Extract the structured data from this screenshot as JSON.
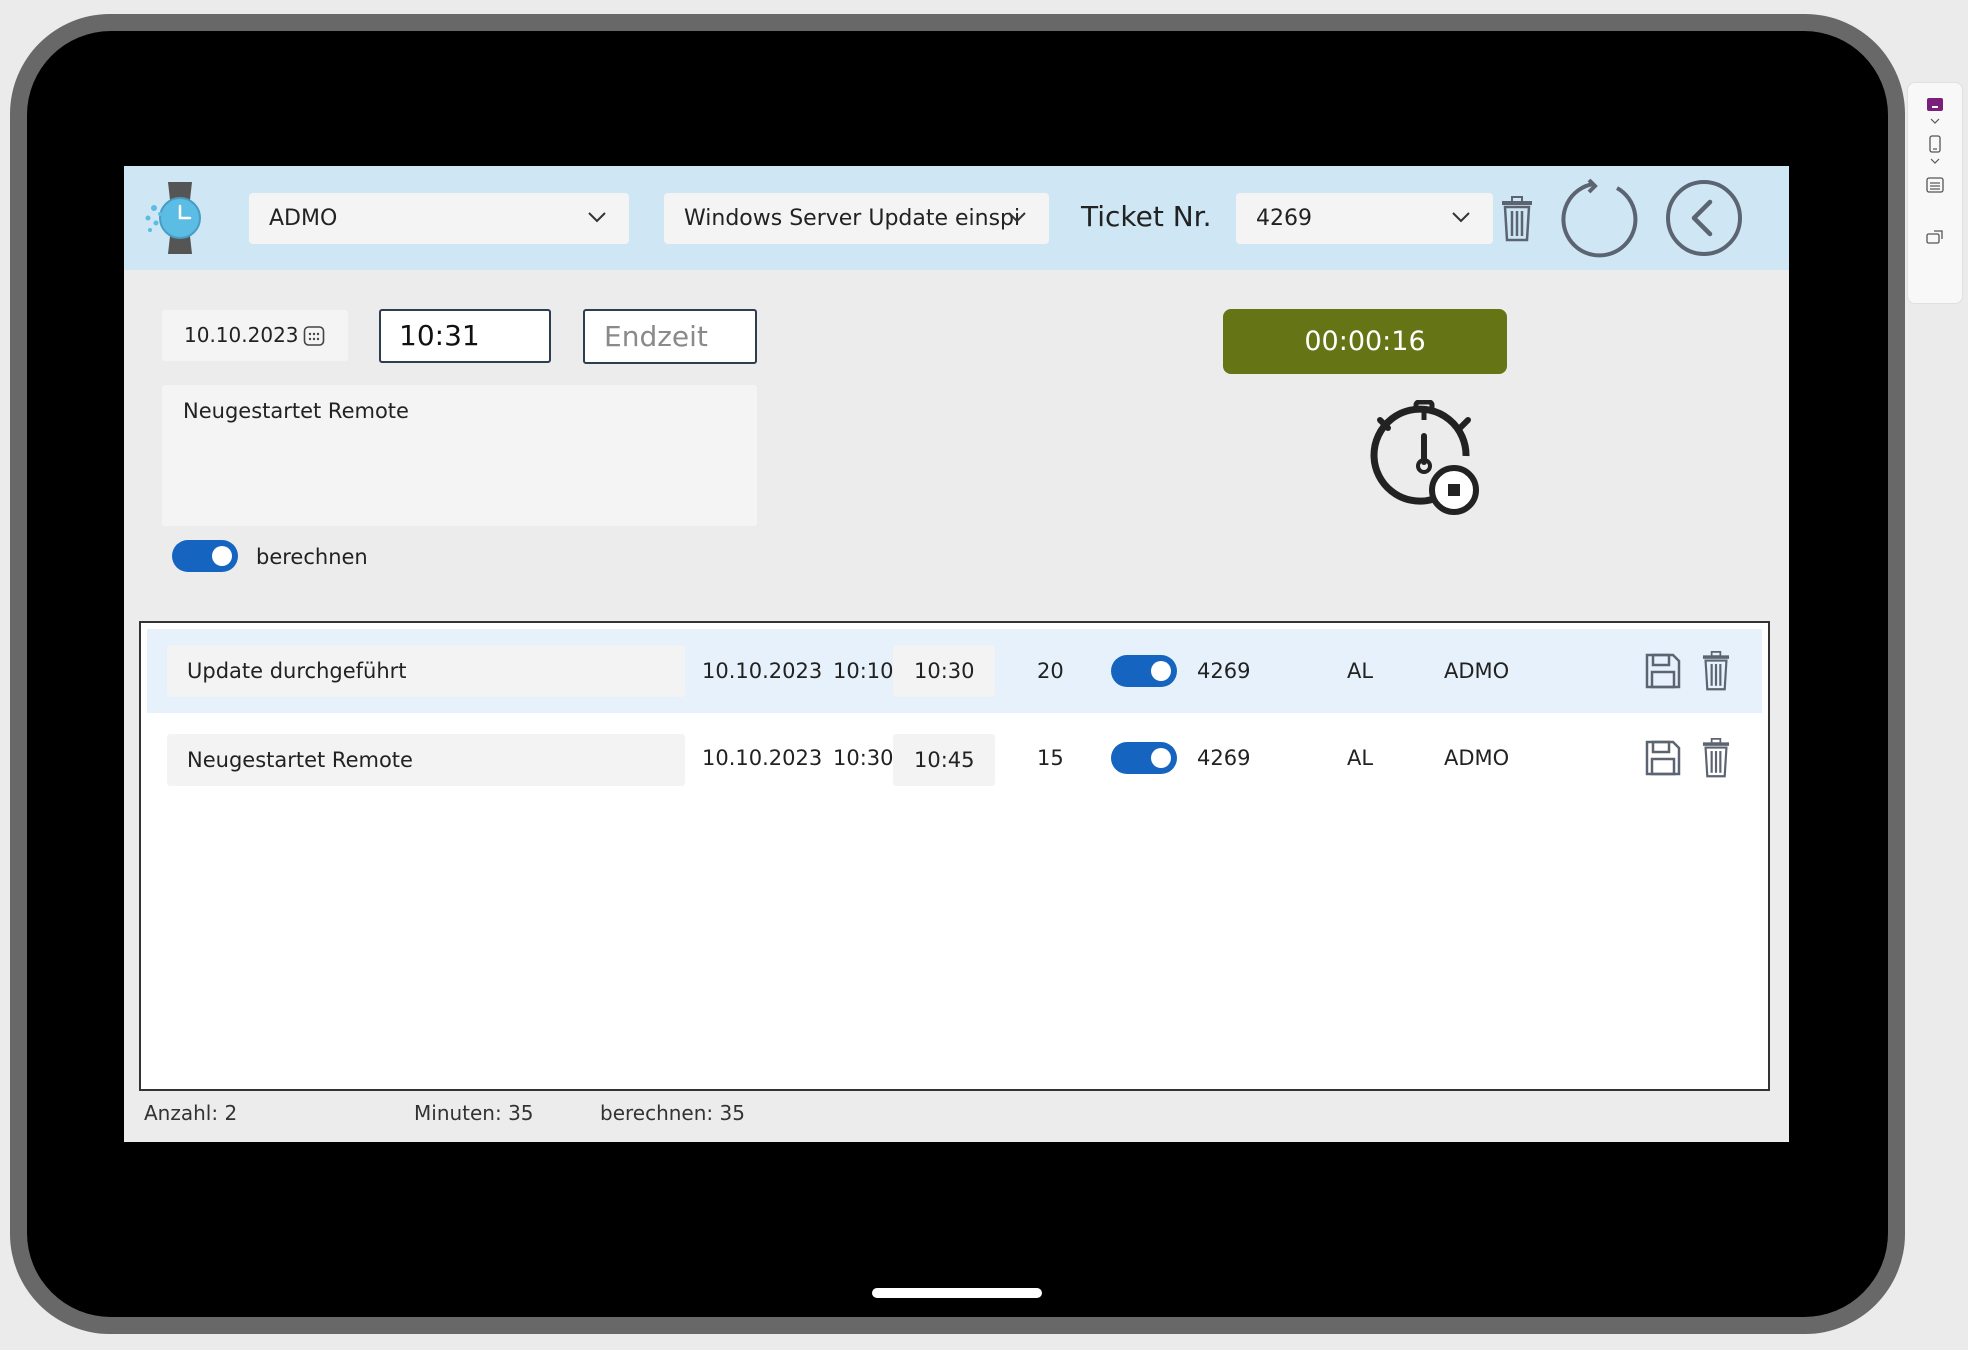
{
  "header": {
    "customer_dropdown": "ADMO",
    "task_dropdown": "Windows Server Update einspi",
    "ticket_label": "Ticket Nr.",
    "ticket_dropdown": "4269"
  },
  "form": {
    "date": "10.10.2023",
    "start_time": "10:31",
    "end_time_placeholder": "Endzeit",
    "note": "Neugestartet Remote",
    "calc_label": "berechnen",
    "calc_enabled": true
  },
  "timer": {
    "elapsed": "00:00:16"
  },
  "entries": [
    {
      "description": "Update durchgeführt",
      "date": "10.10.2023",
      "start": "10:10",
      "end": "10:30",
      "minutes": "20",
      "billable": true,
      "ticket": "4269",
      "user": "AL",
      "customer": "ADMO"
    },
    {
      "description": "Neugestartet Remote",
      "date": "10.10.2023",
      "start": "10:30",
      "end": "10:45",
      "minutes": "15",
      "billable": true,
      "ticket": "4269",
      "user": "AL",
      "customer": "ADMO"
    }
  ],
  "footer": {
    "count": "Anzahl: 2",
    "minutes": "Minuten: 35",
    "billable": "berechnen: 35"
  },
  "colors": {
    "header_bg": "#cfe7f5",
    "timer_bg": "#657414",
    "toggle_on": "#1565c0",
    "icon_gray": "#5b6470",
    "selected_row": "#e6f1fb"
  }
}
